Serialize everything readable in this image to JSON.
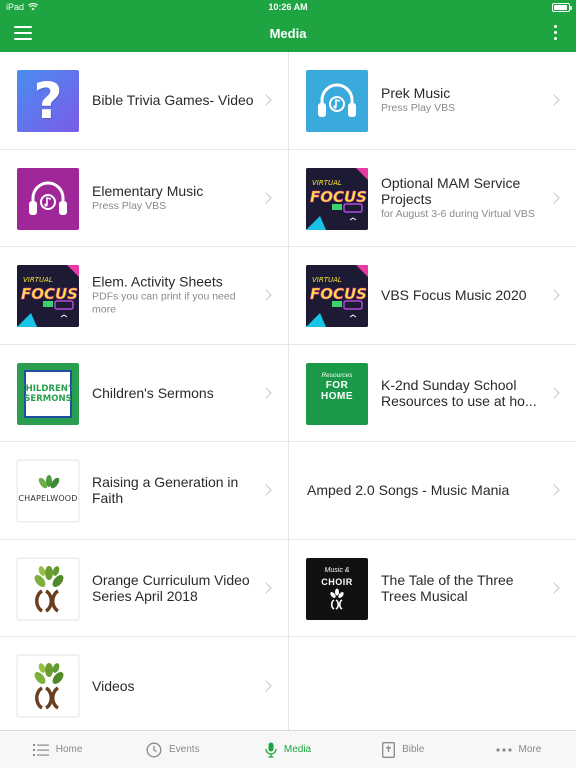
{
  "status": {
    "carrier": "iPad",
    "time": "10:26 AM",
    "battery": 0.9
  },
  "header": {
    "title": "Media"
  },
  "items": [
    {
      "title": "Bible Trivia Games- Video",
      "subtitle": "",
      "thumb": "question"
    },
    {
      "title": "Prek Music",
      "subtitle": "Press Play VBS",
      "thumb": "headphones-blue"
    },
    {
      "title": "Elementary Music",
      "subtitle": "Press Play VBS",
      "thumb": "headphones-purple"
    },
    {
      "title": "Optional MAM Service Projects",
      "subtitle": "for August 3-6 during Virtual VBS",
      "thumb": "focus"
    },
    {
      "title": "Elem. Activity Sheets",
      "subtitle": "PDFs you can print if you need more",
      "thumb": "focus"
    },
    {
      "title": "VBS Focus Music 2020",
      "subtitle": "",
      "thumb": "focus"
    },
    {
      "title": "Children's Sermons",
      "subtitle": "",
      "thumb": "childrens-sermons"
    },
    {
      "title": "K-2nd Sunday School Resources to use at ho...",
      "subtitle": "",
      "thumb": "for-home"
    },
    {
      "title": "Raising a Generation in Faith",
      "subtitle": "",
      "thumb": "chapelwood"
    },
    {
      "title": "Amped 2.0 Songs - Music Mania",
      "subtitle": "",
      "thumb": ""
    },
    {
      "title": "Orange Curriculum Video Series April 2018",
      "subtitle": "",
      "thumb": "tree"
    },
    {
      "title": "The Tale of the Three Trees Musical",
      "subtitle": "",
      "thumb": "music-choir"
    },
    {
      "title": "Videos",
      "subtitle": "",
      "thumb": "tree"
    }
  ],
  "thumb_text": {
    "focus_top": "VIRTUAL",
    "focus_main": "FOCUS",
    "childrens_sermons": "CHILDREN'S SERMONS",
    "for_home_script": "Resources",
    "for_home_main": "FOR HOME",
    "chapelwood": "CHAPELWOOD",
    "choir_script": "Music &",
    "choir_main": "CHOIR"
  },
  "tabs": [
    {
      "label": "Home",
      "icon": "list-icon",
      "active": false
    },
    {
      "label": "Events",
      "icon": "clock-icon",
      "active": false
    },
    {
      "label": "Media",
      "icon": "microphone-icon",
      "active": true
    },
    {
      "label": "Bible",
      "icon": "bible-icon",
      "active": false
    },
    {
      "label": "More",
      "icon": "ellipsis-icon",
      "active": false
    }
  ],
  "colors": {
    "brand_green": "#1ea541",
    "tab_inactive": "#8a8a8a"
  }
}
